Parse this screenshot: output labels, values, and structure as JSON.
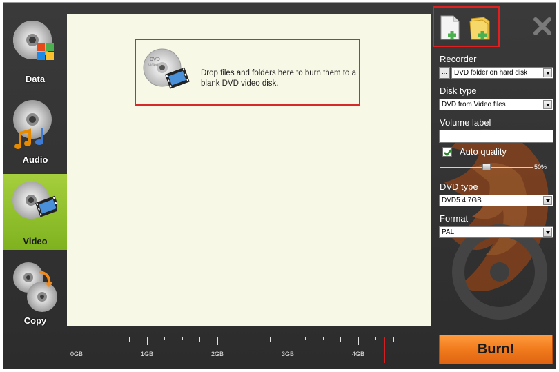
{
  "sidebar": {
    "items": [
      {
        "label": "Data"
      },
      {
        "label": "Audio"
      },
      {
        "label": "Video"
      },
      {
        "label": "Copy"
      }
    ]
  },
  "drop_area": {
    "hint": "Drop files and folders here to burn them to a blank DVD video disk."
  },
  "ruler": {
    "labels": [
      "0GB",
      "1GB",
      "2GB",
      "3GB",
      "4GB"
    ]
  },
  "panel": {
    "recorder_label": "Recorder",
    "recorder_browse": "...",
    "recorder_value": "DVD folder on hard disk",
    "disk_type_label": "Disk type",
    "disk_type_value": "DVD from Video files",
    "volume_label_label": "Volume label",
    "volume_label_value": "",
    "auto_quality_label": "Auto quality",
    "auto_quality_checked": true,
    "quality_value": "50%",
    "quality_fraction": 0.5,
    "dvd_type_label": "DVD type",
    "dvd_type_value": "DVD5 4.7GB",
    "format_label": "Format",
    "format_value": "PAL",
    "burn_label": "Burn!"
  },
  "colors": {
    "active_nav": "#8cbf2a",
    "burn": "#f07a1c",
    "highlight": "#d62a2a"
  },
  "icons": {
    "toolbar": [
      "add-file-icon",
      "add-folder-icon",
      "close-icon"
    ]
  }
}
